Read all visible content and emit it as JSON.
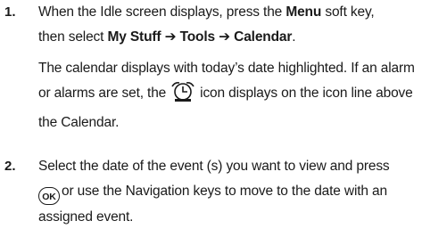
{
  "steps": [
    {
      "number": "1.",
      "line1_a": "When the Idle screen displays, press the ",
      "line1_b": "Menu",
      "line1_c": " soft key,",
      "line2_a": "then select ",
      "line2_b": "My Stuff ➔ Tools ➔ Calendar",
      "line2_c": ".",
      "note_a": "The calendar displays with today’s date highlighted. If an alarm or alarms are set, the",
      "note_icon": "alarm-clock-icon",
      "note_b": "icon displays on the icon line above the Calendar."
    },
    {
      "number": "2.",
      "text_a": "Select the date of the event (s) you want to view and press",
      "ok_icon_label": "OK",
      "text_b": "or use the Navigation keys to move to the date with an assigned event."
    }
  ]
}
